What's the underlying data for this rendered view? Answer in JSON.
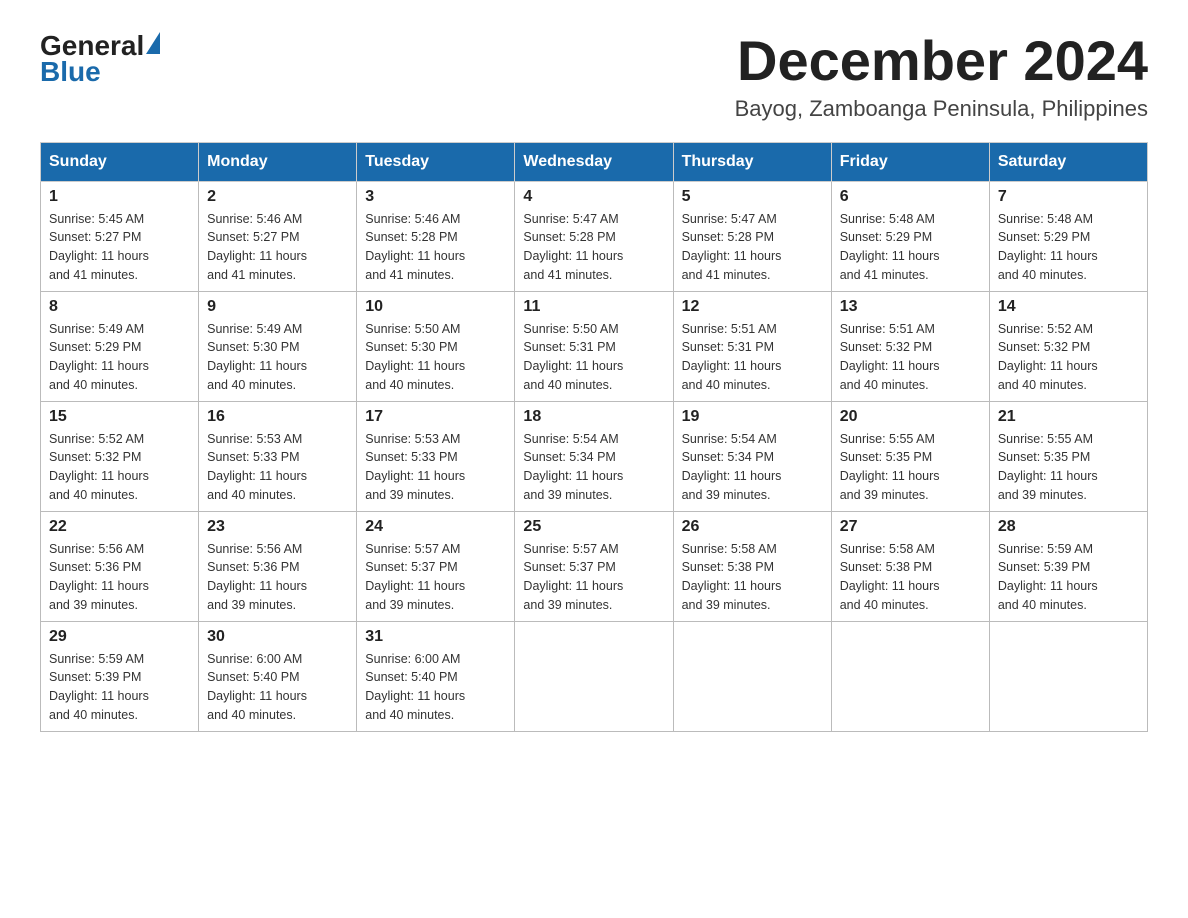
{
  "header": {
    "logo_general": "General",
    "logo_blue": "Blue",
    "month_title": "December 2024",
    "location": "Bayog, Zamboanga Peninsula, Philippines"
  },
  "weekdays": [
    "Sunday",
    "Monday",
    "Tuesday",
    "Wednesday",
    "Thursday",
    "Friday",
    "Saturday"
  ],
  "weeks": [
    [
      {
        "day": "1",
        "sunrise": "5:45 AM",
        "sunset": "5:27 PM",
        "daylight": "11 hours and 41 minutes."
      },
      {
        "day": "2",
        "sunrise": "5:46 AM",
        "sunset": "5:27 PM",
        "daylight": "11 hours and 41 minutes."
      },
      {
        "day": "3",
        "sunrise": "5:46 AM",
        "sunset": "5:28 PM",
        "daylight": "11 hours and 41 minutes."
      },
      {
        "day": "4",
        "sunrise": "5:47 AM",
        "sunset": "5:28 PM",
        "daylight": "11 hours and 41 minutes."
      },
      {
        "day": "5",
        "sunrise": "5:47 AM",
        "sunset": "5:28 PM",
        "daylight": "11 hours and 41 minutes."
      },
      {
        "day": "6",
        "sunrise": "5:48 AM",
        "sunset": "5:29 PM",
        "daylight": "11 hours and 41 minutes."
      },
      {
        "day": "7",
        "sunrise": "5:48 AM",
        "sunset": "5:29 PM",
        "daylight": "11 hours and 40 minutes."
      }
    ],
    [
      {
        "day": "8",
        "sunrise": "5:49 AM",
        "sunset": "5:29 PM",
        "daylight": "11 hours and 40 minutes."
      },
      {
        "day": "9",
        "sunrise": "5:49 AM",
        "sunset": "5:30 PM",
        "daylight": "11 hours and 40 minutes."
      },
      {
        "day": "10",
        "sunrise": "5:50 AM",
        "sunset": "5:30 PM",
        "daylight": "11 hours and 40 minutes."
      },
      {
        "day": "11",
        "sunrise": "5:50 AM",
        "sunset": "5:31 PM",
        "daylight": "11 hours and 40 minutes."
      },
      {
        "day": "12",
        "sunrise": "5:51 AM",
        "sunset": "5:31 PM",
        "daylight": "11 hours and 40 minutes."
      },
      {
        "day": "13",
        "sunrise": "5:51 AM",
        "sunset": "5:32 PM",
        "daylight": "11 hours and 40 minutes."
      },
      {
        "day": "14",
        "sunrise": "5:52 AM",
        "sunset": "5:32 PM",
        "daylight": "11 hours and 40 minutes."
      }
    ],
    [
      {
        "day": "15",
        "sunrise": "5:52 AM",
        "sunset": "5:32 PM",
        "daylight": "11 hours and 40 minutes."
      },
      {
        "day": "16",
        "sunrise": "5:53 AM",
        "sunset": "5:33 PM",
        "daylight": "11 hours and 40 minutes."
      },
      {
        "day": "17",
        "sunrise": "5:53 AM",
        "sunset": "5:33 PM",
        "daylight": "11 hours and 39 minutes."
      },
      {
        "day": "18",
        "sunrise": "5:54 AM",
        "sunset": "5:34 PM",
        "daylight": "11 hours and 39 minutes."
      },
      {
        "day": "19",
        "sunrise": "5:54 AM",
        "sunset": "5:34 PM",
        "daylight": "11 hours and 39 minutes."
      },
      {
        "day": "20",
        "sunrise": "5:55 AM",
        "sunset": "5:35 PM",
        "daylight": "11 hours and 39 minutes."
      },
      {
        "day": "21",
        "sunrise": "5:55 AM",
        "sunset": "5:35 PM",
        "daylight": "11 hours and 39 minutes."
      }
    ],
    [
      {
        "day": "22",
        "sunrise": "5:56 AM",
        "sunset": "5:36 PM",
        "daylight": "11 hours and 39 minutes."
      },
      {
        "day": "23",
        "sunrise": "5:56 AM",
        "sunset": "5:36 PM",
        "daylight": "11 hours and 39 minutes."
      },
      {
        "day": "24",
        "sunrise": "5:57 AM",
        "sunset": "5:37 PM",
        "daylight": "11 hours and 39 minutes."
      },
      {
        "day": "25",
        "sunrise": "5:57 AM",
        "sunset": "5:37 PM",
        "daylight": "11 hours and 39 minutes."
      },
      {
        "day": "26",
        "sunrise": "5:58 AM",
        "sunset": "5:38 PM",
        "daylight": "11 hours and 39 minutes."
      },
      {
        "day": "27",
        "sunrise": "5:58 AM",
        "sunset": "5:38 PM",
        "daylight": "11 hours and 40 minutes."
      },
      {
        "day": "28",
        "sunrise": "5:59 AM",
        "sunset": "5:39 PM",
        "daylight": "11 hours and 40 minutes."
      }
    ],
    [
      {
        "day": "29",
        "sunrise": "5:59 AM",
        "sunset": "5:39 PM",
        "daylight": "11 hours and 40 minutes."
      },
      {
        "day": "30",
        "sunrise": "6:00 AM",
        "sunset": "5:40 PM",
        "daylight": "11 hours and 40 minutes."
      },
      {
        "day": "31",
        "sunrise": "6:00 AM",
        "sunset": "5:40 PM",
        "daylight": "11 hours and 40 minutes."
      },
      null,
      null,
      null,
      null
    ]
  ],
  "labels": {
    "sunrise": "Sunrise:",
    "sunset": "Sunset:",
    "daylight": "Daylight:"
  }
}
